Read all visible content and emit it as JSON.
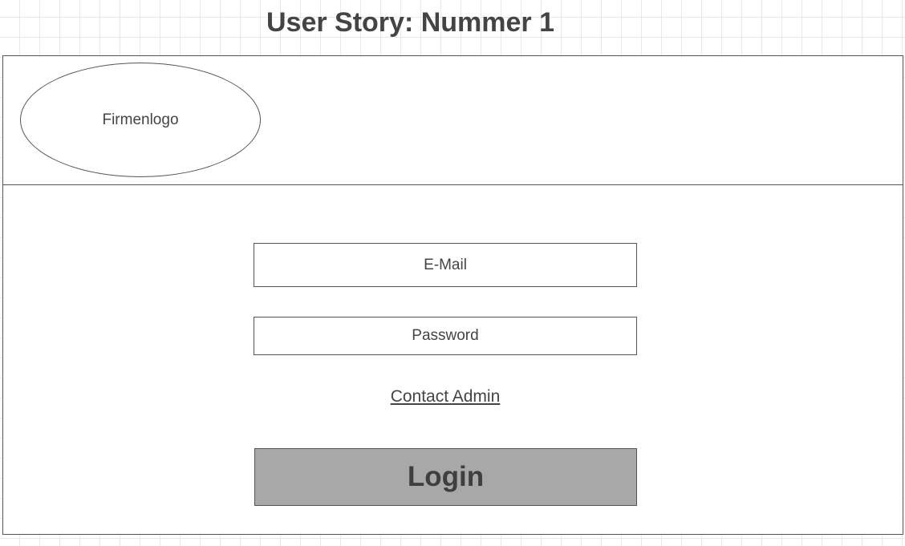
{
  "page": {
    "title": "User Story: Nummer 1"
  },
  "header": {
    "logo_label": "Firmenlogo"
  },
  "login_form": {
    "email_placeholder": "E-Mail",
    "password_placeholder": "Password",
    "contact_link": "Contact Admin",
    "login_button": "Login"
  },
  "colors": {
    "button_fill": "#a8a8a8",
    "border": "#555555",
    "text": "#444444"
  }
}
